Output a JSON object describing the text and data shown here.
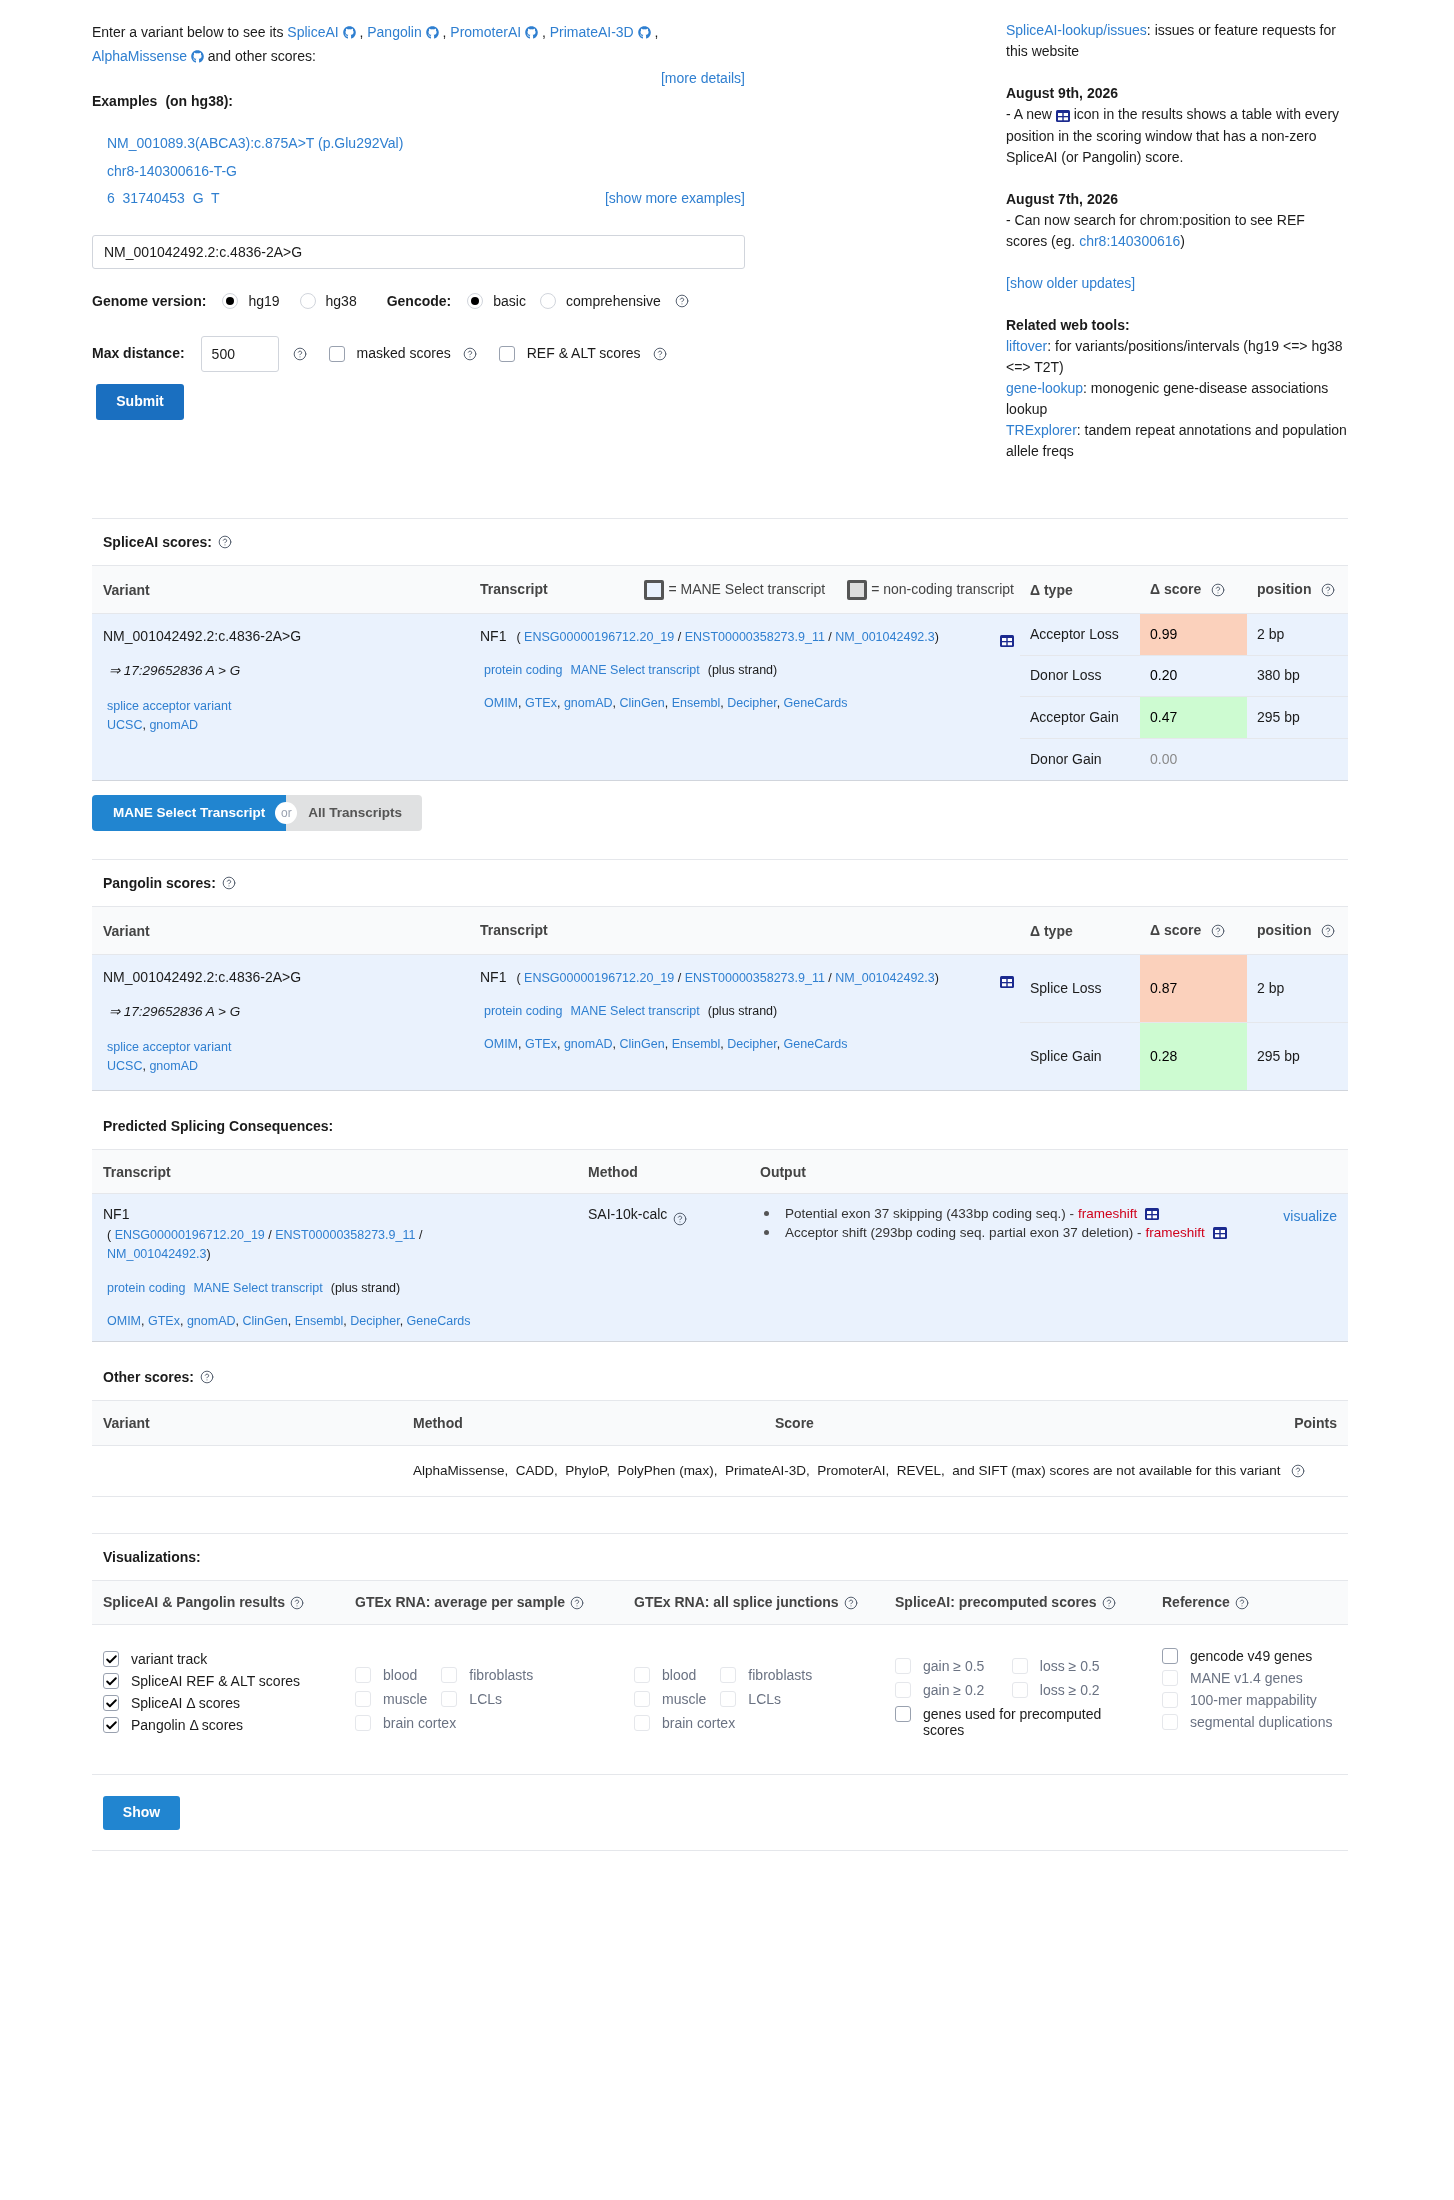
{
  "intro": {
    "prefix": "Enter a variant below to see its",
    "tools": [
      {
        "label": "SpliceAI",
        "after": ","
      },
      {
        "label": "Pangolin",
        "after": ","
      },
      {
        "label": "PromoterAI",
        "after": ","
      },
      {
        "label": "PrimateAI-3D",
        "after": ","
      },
      {
        "label": "AlphaMissense"
      }
    ],
    "suffix": "and other scores:",
    "more": "[more details]"
  },
  "examples": {
    "title": "Examples",
    "note": "(on hg38):",
    "items": [
      "NM_001089.3(ABCA3):c.875A>T (p.Glu292Val)",
      "chr8-140300616-T-G",
      "6  31740453  G  T"
    ],
    "more": "[show more examples]"
  },
  "search": {
    "value": "NM_001042492.2:c.4836-2A>G"
  },
  "genome": {
    "label": "Genome version:",
    "options": [
      {
        "label": "hg19",
        "selected": true
      },
      {
        "label": "hg38",
        "selected": false
      }
    ]
  },
  "gencode": {
    "label": "Gencode:",
    "options": [
      {
        "label": "basic",
        "selected": true
      },
      {
        "label": "comprehensive",
        "selected": false
      }
    ]
  },
  "max_distance": {
    "label": "Max distance:",
    "value": "500"
  },
  "toggles": [
    {
      "label": "masked scores",
      "checked": false
    },
    {
      "label": "REF & ALT scores",
      "checked": false
    }
  ],
  "submit": "Submit",
  "sidebar": {
    "issues": {
      "link": "SpliceAI-lookup/issues",
      "text": ": issues or feature requests for this website"
    },
    "update1": {
      "date": "August 9th, 2026",
      "before": "- A new",
      "after": "icon in the results shows a table with every position in the scoring window that has a non-zero SpliceAI (or Pangolin) score."
    },
    "update2": {
      "date": "August 7th, 2026",
      "before": "- Can now search for chrom:position to see REF scores (eg.",
      "link": "chr8:140300616",
      "after": ")"
    },
    "older": "[show older updates]",
    "related": {
      "title": "Related web tools:",
      "tools": [
        {
          "link": "liftover",
          "text": ": for variants/positions/intervals (hg19 <=> hg38 <=> T2T)"
        },
        {
          "link": "gene-lookup",
          "text": ": monogenic gene-disease associations lookup"
        },
        {
          "link": "TRExplorer",
          "text": ": tandem repeat annotations and population allele freqs"
        }
      ]
    }
  },
  "spliceai": {
    "title": "SpliceAI scores:",
    "columns": {
      "variant": "Variant",
      "transcript": "Transcript",
      "mane_legend": "= MANE Select transcript",
      "noncoding_legend": "= non-coding transcript",
      "type": "Δ type",
      "score": "Δ score",
      "position": "position"
    },
    "variant": {
      "hgvs": "NM_001042492.2:c.4836-2A>G",
      "genomic": "⇒ 17:29652836 A > G",
      "consequence": "splice acceptor variant",
      "links": [
        "UCSC",
        "gnomAD"
      ],
      "sep": ","
    },
    "transcript": {
      "gene": "NF1",
      "open": "(",
      "ids": [
        "ENSG00000196712.20_19",
        "ENST00000358273.9_11",
        "NM_001042492.3"
      ],
      "id_sep": "/",
      "close": ")",
      "tags": [
        "protein coding",
        "MANE Select transcript"
      ],
      "strand": "(plus strand)",
      "links": [
        "OMIM",
        "GTEx",
        "gnomAD",
        "ClinGen",
        "Ensembl",
        "Decipher",
        "GeneCards"
      ],
      "sep": ","
    },
    "rows": [
      {
        "type": "Acceptor Loss",
        "score": "0.99",
        "position": "2 bp",
        "color": "#fbd1bc",
        "muted": false
      },
      {
        "type": "Donor Loss",
        "score": "0.20",
        "position": "380 bp",
        "muted": false
      },
      {
        "type": "Acceptor Gain",
        "score": "0.47",
        "position": "295 bp",
        "color": "#cdfbd1",
        "muted": false
      },
      {
        "type": "Donor Gain",
        "score": "0.00",
        "position": "",
        "muted": true
      }
    ]
  },
  "view_toggle": {
    "options": [
      {
        "label": "MANE Select Transcript",
        "selected": true
      },
      {
        "label": "All Transcripts",
        "selected": false
      }
    ],
    "or": "or"
  },
  "pangolin": {
    "title": "Pangolin scores:",
    "columns": {
      "variant": "Variant",
      "transcript": "Transcript",
      "type": "Δ type",
      "score": "Δ score",
      "position": "position"
    },
    "variant": {
      "hgvs": "NM_001042492.2:c.4836-2A>G",
      "genomic": "⇒ 17:29652836 A > G",
      "consequence": "splice acceptor variant",
      "links": [
        "UCSC",
        "gnomAD"
      ],
      "sep": ","
    },
    "transcript": {
      "gene": "NF1",
      "open": "(",
      "ids": [
        "ENSG00000196712.20_19",
        "ENST00000358273.9_11",
        "NM_001042492.3"
      ],
      "id_sep": "/",
      "close": ")",
      "tags": [
        "protein coding",
        "MANE Select transcript"
      ],
      "strand": "(plus strand)",
      "links": [
        "OMIM",
        "GTEx",
        "gnomAD",
        "ClinGen",
        "Ensembl",
        "Decipher",
        "GeneCards"
      ],
      "sep": ","
    },
    "rows": [
      {
        "type": "Splice Loss",
        "score": "0.87",
        "position": "2 bp",
        "color": "#fbd1bc",
        "muted": false
      },
      {
        "type": "Splice Gain",
        "score": "0.28",
        "position": "295 bp",
        "color": "#cdfbd1",
        "muted": false
      }
    ]
  },
  "consequences": {
    "title": "Predicted Splicing Consequences:",
    "columns": [
      "Transcript",
      "Method",
      "Output"
    ],
    "transcript": {
      "gene": "NF1",
      "open": "(",
      "ids": [
        "ENSG00000196712.20_19",
        "ENST00000358273.9_11",
        "NM_001042492.3"
      ],
      "id_sep": "/",
      "close": ")",
      "tags": [
        "protein coding",
        "MANE Select transcript"
      ],
      "strand": "(plus strand)",
      "links": [
        "OMIM",
        "GTEx",
        "gnomAD",
        "ClinGen",
        "Ensembl",
        "Decipher",
        "GeneCards"
      ],
      "sep": ","
    },
    "method": "SAI-10k-calc",
    "outputs": [
      {
        "text": "Potential exon 37 skipping (433bp coding seq.) -",
        "effect": "frameshift"
      },
      {
        "text": "Acceptor shift (293bp coding seq. partial exon 37 deletion) -",
        "effect": "frameshift"
      }
    ],
    "visualize": "visualize"
  },
  "other": {
    "title": "Other scores:",
    "columns": [
      "Variant",
      "Method",
      "Score",
      "Points"
    ],
    "message": "AlphaMissense,  CADD,  PhyloP,  PolyPhen (max),  PrimateAI-3D,  PromoterAI,  REVEL,  and SIFT (max) scores are not available for this variant"
  },
  "visualizations": {
    "title": "Visualizations:",
    "groups": [
      {
        "title": "SpliceAI & Pangolin results",
        "kind": "list",
        "items": [
          {
            "label": "variant track",
            "checked": true,
            "disabled": false
          },
          {
            "label": "SpliceAI REF & ALT scores",
            "checked": true,
            "disabled": false
          },
          {
            "label": "SpliceAI Δ scores",
            "checked": true,
            "disabled": false
          },
          {
            "label": "Pangolin Δ  scores",
            "checked": true,
            "disabled": false
          }
        ]
      },
      {
        "title": "GTEx RNA: average per sample",
        "kind": "grid",
        "items": [
          {
            "label": "blood",
            "checked": false,
            "disabled": true
          },
          {
            "label": "fibroblasts",
            "checked": false,
            "disabled": true
          },
          {
            "label": "muscle",
            "checked": false,
            "disabled": true
          },
          {
            "label": "LCLs",
            "checked": false,
            "disabled": true
          },
          {
            "label": "brain cortex",
            "checked": false,
            "disabled": true
          }
        ]
      },
      {
        "title": "GTEx RNA: all splice junctions",
        "kind": "grid",
        "items": [
          {
            "label": "blood",
            "checked": false,
            "disabled": true
          },
          {
            "label": "fibroblasts",
            "checked": false,
            "disabled": true
          },
          {
            "label": "muscle",
            "checked": false,
            "disabled": true
          },
          {
            "label": "LCLs",
            "checked": false,
            "disabled": true
          },
          {
            "label": "brain cortex",
            "checked": false,
            "disabled": true
          }
        ]
      },
      {
        "title": "SpliceAI: precomputed scores",
        "kind": "grid",
        "items": [
          {
            "label": "gain ≥ 0.5",
            "checked": false,
            "disabled": true
          },
          {
            "label": "loss ≥ 0.5",
            "checked": false,
            "disabled": true
          },
          {
            "label": "gain ≥ 0.2",
            "checked": false,
            "disabled": true
          },
          {
            "label": "loss ≥ 0.2",
            "checked": false,
            "disabled": true
          },
          {
            "label": "genes used for precomputed scores",
            "checked": false,
            "disabled": false
          }
        ]
      },
      {
        "title": "Reference",
        "kind": "list",
        "items": [
          {
            "label": "gencode v49 genes",
            "checked": false,
            "disabled": false
          },
          {
            "label": "MANE v1.4 genes",
            "checked": false,
            "disabled": true
          },
          {
            "label": "100-mer mappability",
            "checked": false,
            "disabled": true
          },
          {
            "label": "segmental duplications",
            "checked": false,
            "disabled": true
          }
        ]
      }
    ],
    "show": "Show"
  }
}
